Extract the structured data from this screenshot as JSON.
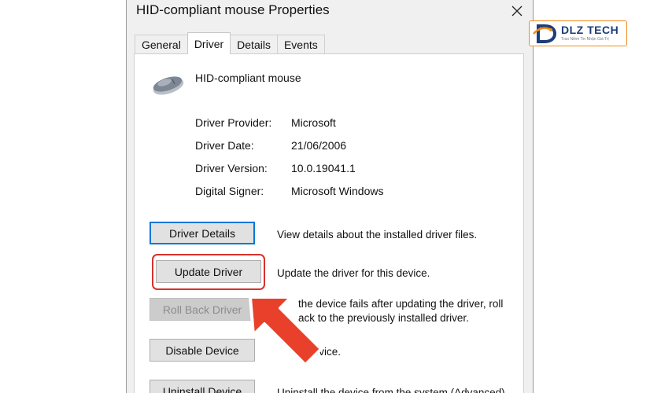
{
  "window": {
    "title": "HID-compliant mouse Properties"
  },
  "tabs": [
    {
      "label": "General"
    },
    {
      "label": "Driver",
      "active": true
    },
    {
      "label": "Details"
    },
    {
      "label": "Events"
    }
  ],
  "device": {
    "name": "HID-compliant mouse",
    "icon": "mouse-icon"
  },
  "driver_info": [
    {
      "label": "Driver Provider:",
      "value": "Microsoft"
    },
    {
      "label": "Driver Date:",
      "value": "21/06/2006"
    },
    {
      "label": "Driver Version:",
      "value": "10.0.19041.1"
    },
    {
      "label": "Digital Signer:",
      "value": "Microsoft Windows"
    }
  ],
  "actions": [
    {
      "label": "Driver Details",
      "description": "View details about the installed driver files.",
      "state": "focused"
    },
    {
      "label": "Update Driver",
      "description": "Update the driver for this device.",
      "state": "highlighted"
    },
    {
      "label": "Roll Back Driver",
      "description_line1": "the device fails after updating the driver, roll",
      "description_line2": "ack to the previously installed driver.",
      "state": "disabled"
    },
    {
      "label": "Disable Device",
      "description": "e device.",
      "state": "normal"
    },
    {
      "label": "Uninstall Device",
      "description": "Uninstall the device from the system (Advanced).",
      "state": "normal"
    }
  ],
  "annotation": {
    "highlight_color": "#d8312b",
    "arrow_color": "#e8402a"
  },
  "logo": {
    "brand": "DLZ TECH",
    "tagline": "Trao Niềm Tin Nhận Giá Trị",
    "accent": "#f08c1e",
    "brand_color": "#1d3d7a"
  }
}
